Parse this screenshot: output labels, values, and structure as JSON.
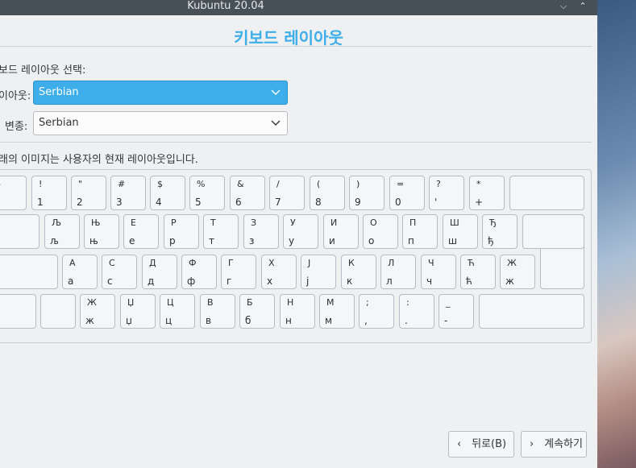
{
  "window": {
    "title": "Kubuntu 20.04",
    "minimize_glyph": "⌵",
    "maximize_glyph": "⌃"
  },
  "page": {
    "title": "키보드 레이아웃",
    "select_label": "보드 레이아웃 선택:",
    "layout_label": "이아웃:",
    "variant_label": "변종:",
    "preview_text": "래의 이미지는 사용자의 현재 레이아웃입니다."
  },
  "layout_combo": {
    "value": "Serbian"
  },
  "variant_combo": {
    "value": "Serbian"
  },
  "keyboard": {
    "row1": [
      {
        "top": "-",
        "bot": ""
      },
      {
        "top": "!",
        "bot": "1"
      },
      {
        "top": "\"",
        "bot": "2"
      },
      {
        "top": "#",
        "bot": "3"
      },
      {
        "top": "$",
        "bot": "4"
      },
      {
        "top": "%",
        "bot": "5"
      },
      {
        "top": "&",
        "bot": "6"
      },
      {
        "top": "/",
        "bot": "7"
      },
      {
        "top": "(",
        "bot": "8"
      },
      {
        "top": ")",
        "bot": "9"
      },
      {
        "top": "=",
        "bot": "0"
      },
      {
        "top": "?",
        "bot": "'"
      },
      {
        "top": "*",
        "bot": "+"
      },
      {
        "top": "",
        "bot": ""
      }
    ],
    "row2": [
      {
        "top": "",
        "bot": ""
      },
      {
        "top": "Љ",
        "bot": "љ"
      },
      {
        "top": "Њ",
        "bot": "њ"
      },
      {
        "top": "Е",
        "bot": "е"
      },
      {
        "top": "Р",
        "bot": "р"
      },
      {
        "top": "Т",
        "bot": "т"
      },
      {
        "top": "З",
        "bot": "з"
      },
      {
        "top": "У",
        "bot": "у"
      },
      {
        "top": "И",
        "bot": "и"
      },
      {
        "top": "О",
        "bot": "о"
      },
      {
        "top": "П",
        "bot": "п"
      },
      {
        "top": "Ш",
        "bot": "ш"
      },
      {
        "top": "Ђ",
        "bot": "ђ"
      },
      {
        "top": "",
        "bot": ""
      }
    ],
    "row3": [
      {
        "top": "",
        "bot": ""
      },
      {
        "top": "А",
        "bot": "а"
      },
      {
        "top": "С",
        "bot": "с"
      },
      {
        "top": "Д",
        "bot": "д"
      },
      {
        "top": "Ф",
        "bot": "ф"
      },
      {
        "top": "Г",
        "bot": "г"
      },
      {
        "top": "Х",
        "bot": "х"
      },
      {
        "top": "Ј",
        "bot": "ј"
      },
      {
        "top": "К",
        "bot": "к"
      },
      {
        "top": "Л",
        "bot": "л"
      },
      {
        "top": "Ч",
        "bot": "ч"
      },
      {
        "top": "Ћ",
        "bot": "ћ"
      },
      {
        "top": "Ж",
        "bot": "ж"
      }
    ],
    "row4": [
      {
        "top": "",
        "bot": ""
      },
      {
        "top": "",
        "bot": ""
      },
      {
        "top": "Ж",
        "bot": "ж"
      },
      {
        "top": "Џ",
        "bot": "џ"
      },
      {
        "top": "Ц",
        "bot": "ц"
      },
      {
        "top": "В",
        "bot": "в"
      },
      {
        "top": "Б",
        "bot": "б"
      },
      {
        "top": "Н",
        "bot": "н"
      },
      {
        "top": "М",
        "bot": "м"
      },
      {
        "top": ";",
        "bot": ","
      },
      {
        "top": ":",
        "bot": "."
      },
      {
        "top": "_",
        "bot": "-"
      },
      {
        "top": "",
        "bot": ""
      }
    ]
  },
  "buttons": {
    "back_label": "뒤로(B)",
    "next_label": "계속하기",
    "back_arrow": "‹",
    "next_arrow": "›"
  }
}
